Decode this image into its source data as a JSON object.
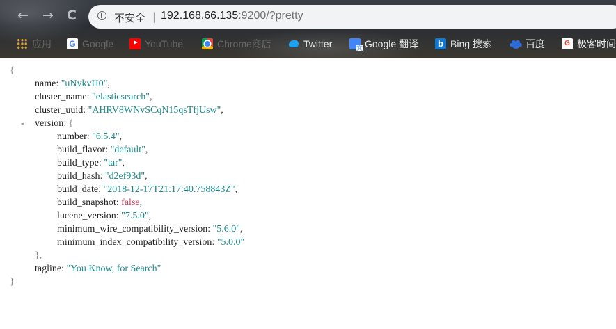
{
  "browser": {
    "nav": {
      "back_glyph": "←",
      "forward_glyph": "→",
      "reload_glyph": "C"
    },
    "address_bar": {
      "security_label": "不安全",
      "separator": "|",
      "url_host": "192.168.66.135",
      "url_rest": ":9200/?pretty"
    },
    "bookmarks": [
      {
        "label": "应用",
        "icon": "apps-grid-icon"
      },
      {
        "label": "Google",
        "icon": "google-icon"
      },
      {
        "label": "YouTube",
        "icon": "youtube-icon"
      },
      {
        "label": "Chrome商店",
        "icon": "chrome-web-store-icon"
      },
      {
        "label": "Twitter",
        "icon": "twitter-icon"
      },
      {
        "label": "Google 翻译",
        "icon": "google-translate-icon"
      },
      {
        "label": "Bing 搜索",
        "icon": "bing-icon"
      },
      {
        "label": "百度",
        "icon": "baidu-icon"
      },
      {
        "label": "极客时间",
        "icon": "geek-time-icon"
      }
    ]
  },
  "json_view": {
    "open_brace": "{",
    "close_brace": "}",
    "name_key": "name",
    "name_val": "\"uNykvH0\"",
    "cluster_name_key": "cluster_name",
    "cluster_name_val": "\"elasticsearch\"",
    "cluster_uuid_key": "cluster_uuid",
    "cluster_uuid_val": "\"AHRV8WNvSCqN15qsTfjUsw\"",
    "collapse_toggle": "-",
    "version_key": "version",
    "version_open": "{",
    "version": {
      "number_key": "number",
      "number_val": "\"6.5.4\"",
      "build_flavor_key": "build_flavor",
      "build_flavor_val": "\"default\"",
      "build_type_key": "build_type",
      "build_type_val": "\"tar\"",
      "build_hash_key": "build_hash",
      "build_hash_val": "\"d2ef93d\"",
      "build_date_key": "build_date",
      "build_date_val": "\"2018-12-17T21:17:40.758843Z\"",
      "build_snapshot_key": "build_snapshot",
      "build_snapshot_val": "false",
      "lucene_version_key": "lucene_version",
      "lucene_version_val": "\"7.5.0\"",
      "min_wire_key": "minimum_wire_compatibility_version",
      "min_wire_val": "\"5.6.0\"",
      "min_index_key": "minimum_index_compatibility_version",
      "min_index_val": "\"5.0.0\""
    },
    "version_close": "},",
    "tagline_key": "tagline",
    "tagline_val": "\"You Know, for Search\""
  },
  "colors": {
    "string": "#1a8a8a",
    "boolean": "#c83c5a",
    "key": "#222222"
  }
}
